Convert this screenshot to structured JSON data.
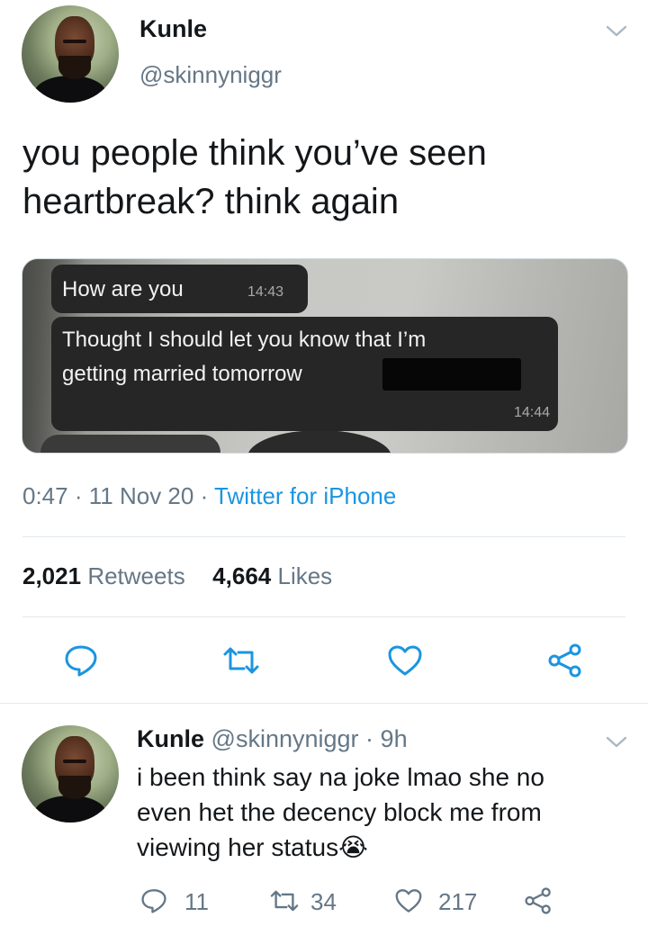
{
  "tweet": {
    "author_name": "Kunle",
    "author_handle": "@skinnyniggr",
    "text_line1": "you people think you’ve seen",
    "text_line2": "heartbreak? think again",
    "media": {
      "bubble1_text": "How are you",
      "bubble1_time": "14:43",
      "bubble2_line1": "Thought I should let you know that I’m",
      "bubble2_line2": "getting married tomorrow",
      "bubble2_time": "14:44"
    },
    "meta": {
      "time": "0:47",
      "dot1": "·",
      "date": "11 Nov 20",
      "dot2": "·",
      "source": "Twitter for iPhone"
    },
    "stats": {
      "retweets_count": "2,021",
      "retweets_label": "Retweets",
      "likes_count": "4,664",
      "likes_label": "Likes"
    },
    "actions": [
      "reply-icon",
      "retweet-icon",
      "like-icon",
      "share-icon"
    ]
  },
  "reply": {
    "author_name": "Kunle",
    "author_handle": "@skinnyniggr",
    "dot": "·",
    "time": "9h",
    "text_line1": "i been think say na joke lmao she no",
    "text_line2": "even het the decency block me from",
    "text_line3": "viewing her status",
    "emoji": "😭",
    "reply_count": "11",
    "retweet_count": "34",
    "like_count": "217"
  },
  "colors": {
    "accent": "#1b95e0",
    "muted": "#657786",
    "divider": "#e1e8ed"
  }
}
